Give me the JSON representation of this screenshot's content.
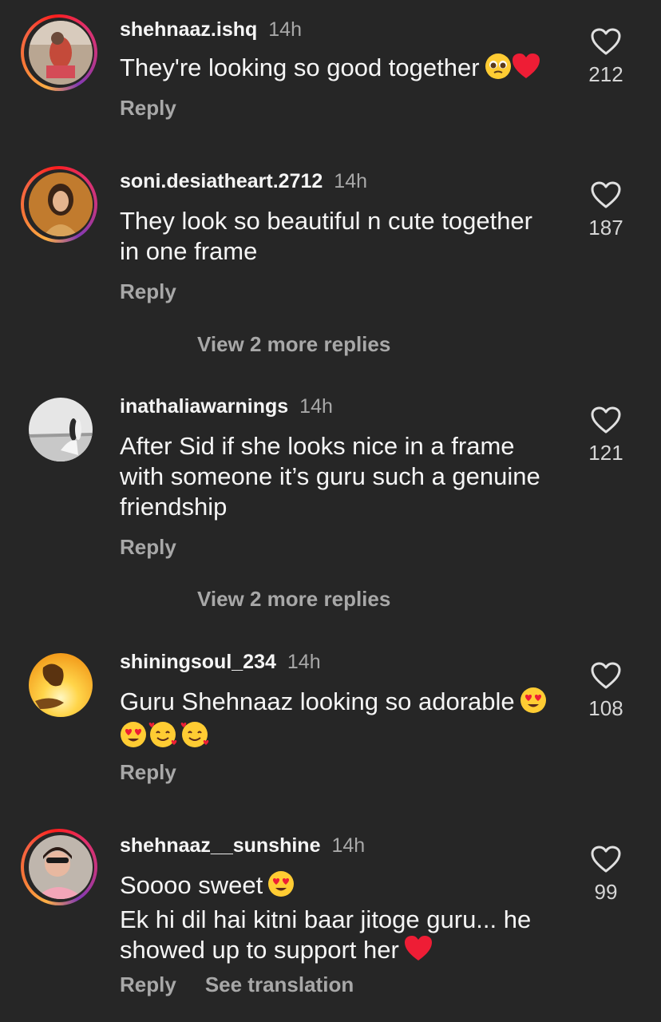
{
  "comments": [
    {
      "username": "shehnaaz.ishq",
      "time": "14h",
      "lines": [
        "They're looking so good together"
      ],
      "trailing_emojis": [
        "pleading-face",
        "red-heart"
      ],
      "likes": "212",
      "reply_label": "Reply",
      "story_ring": true
    },
    {
      "username": "soni.desiatheart.2712",
      "time": "14h",
      "lines": [
        "They look so beautiful n cute together",
        "in one frame"
      ],
      "likes": "187",
      "reply_label": "Reply",
      "view_replies": "View 2 more replies",
      "story_ring": true
    },
    {
      "username": "inathaliawarnings",
      "time": "14h",
      "lines": [
        "After Sid if she looks nice in a frame",
        "with someone it’s guru such a genuine",
        "friendship"
      ],
      "likes": "121",
      "reply_label": "Reply",
      "view_replies": "View 2 more replies",
      "story_ring": false
    },
    {
      "username": "shiningsoul_234",
      "time": "14h",
      "lines": [
        "Guru Shehnaaz looking so adorable"
      ],
      "trailing_emojis": [
        "heart-eyes"
      ],
      "second_line_emojis": [
        "heart-eyes",
        "smiling-face-with-hearts",
        "smiling-face-with-hearts"
      ],
      "likes": "108",
      "reply_label": "Reply",
      "story_ring": false
    },
    {
      "username": "shehnaaz__sunshine",
      "time": "14h",
      "lines": [
        "Soooo sweet",
        "Ek hi dil hai kitni baar jitoge guru... he",
        "showed up to support her"
      ],
      "likes": "99",
      "reply_label": "Reply",
      "see_translation": "See translation",
      "story_ring": true
    }
  ],
  "colors": {
    "background": "#262626",
    "text_primary": "#f5f5f5",
    "text_secondary": "#a8a8a8",
    "heart_red": "#ee1d35",
    "emoji_yellow": "#ffcc33"
  }
}
